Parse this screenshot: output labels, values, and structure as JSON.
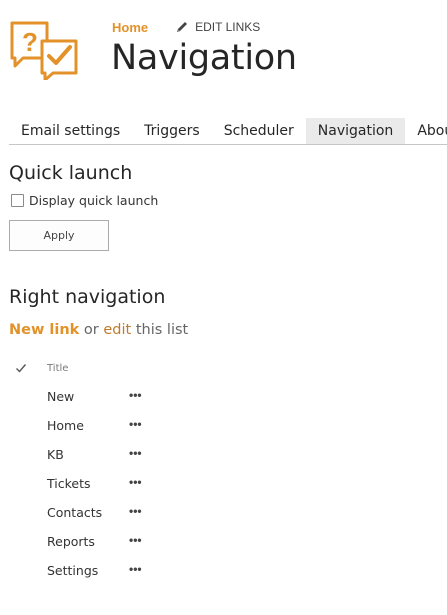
{
  "header": {
    "home_link": "Home",
    "edit_links": "EDIT LINKS",
    "page_title": "Navigation"
  },
  "tabs": [
    {
      "label": "Email settings",
      "active": false
    },
    {
      "label": "Triggers",
      "active": false
    },
    {
      "label": "Scheduler",
      "active": false
    },
    {
      "label": "Navigation",
      "active": true
    },
    {
      "label": "About",
      "active": false
    }
  ],
  "quick_launch": {
    "title": "Quick launch",
    "checkbox_label": "Display quick launch",
    "checkbox_checked": false,
    "apply_label": "Apply"
  },
  "right_navigation": {
    "title": "Right navigation",
    "new_link": "New link",
    "or_text": " or ",
    "edit_text": "edit",
    "this_list_text": " this list",
    "column_title": "Title",
    "items": [
      {
        "title": "New",
        "menu": "•••"
      },
      {
        "title": "Home",
        "menu": "•••"
      },
      {
        "title": "KB",
        "menu": "•••"
      },
      {
        "title": "Tickets",
        "menu": "•••"
      },
      {
        "title": "Contacts",
        "menu": "•••"
      },
      {
        "title": "Reports",
        "menu": "•••"
      },
      {
        "title": "Settings",
        "menu": "•••"
      }
    ]
  },
  "colors": {
    "accent": "#e3922a",
    "active_tab_bg": "#eaeaea"
  },
  "icons": {
    "logo": "question-check-speech-bubbles-icon",
    "edit": "pencil-icon",
    "select_all": "checkmark-icon"
  }
}
